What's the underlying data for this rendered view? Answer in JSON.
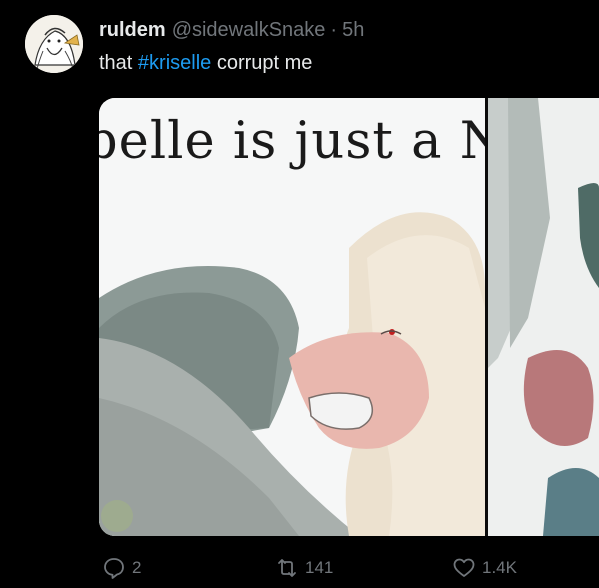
{
  "tweet": {
    "display_name": "ruldem",
    "handle": "@sidewalkSnake",
    "separator": "·",
    "time": "5h",
    "text_before": "that ",
    "hashtag": "#kriselle",
    "text_after": " corrupt me"
  },
  "media": {
    "caption_text": "belle is just a N"
  },
  "actions": {
    "replies": "2",
    "reposts": "141",
    "likes": "1.4K"
  },
  "colors": {
    "background": "#000000",
    "hashtag": "#1d9bf0",
    "muted": "#71767b",
    "text": "#e7e9ea"
  }
}
